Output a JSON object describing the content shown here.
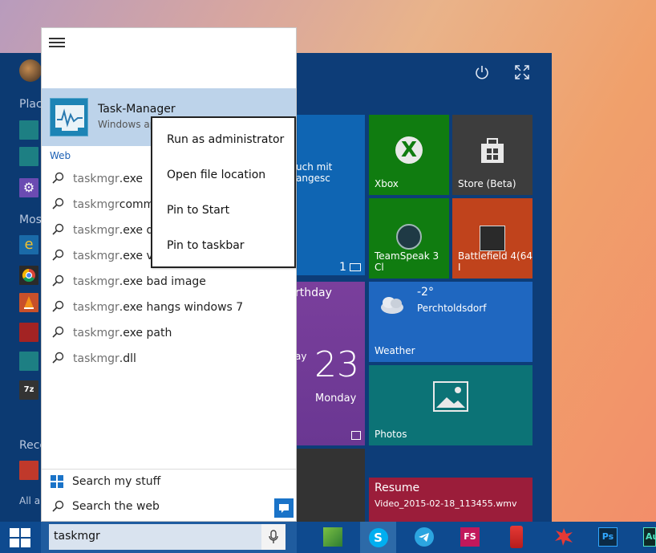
{
  "search_panel": {
    "best_match": {
      "title": "Task-Manager",
      "subtitle": "Windows ap"
    },
    "web_header": "Web",
    "suggestions": [
      {
        "query": "taskmgr",
        "rest": ".exe"
      },
      {
        "query": "taskmgr",
        "rest": " comm"
      },
      {
        "query": "taskmgr",
        "rest": ".exe do"
      },
      {
        "query": "taskmgr",
        "rest": ".exe vir"
      },
      {
        "query": "taskmgr",
        "rest": ".exe bad image"
      },
      {
        "query": "taskmgr",
        "rest": ".exe hangs windows 7"
      },
      {
        "query": "taskmgr",
        "rest": ".exe path"
      },
      {
        "query": "taskmgr",
        "rest": ".dll"
      }
    ],
    "search_my_stuff": "Search my stuff",
    "search_the_web": "Search the web"
  },
  "context_menu": {
    "items": [
      "Run as administrator",
      "Open file location",
      "Pin to Start",
      "Pin to taskbar"
    ]
  },
  "start_menu": {
    "left_labels": {
      "places": "Plac",
      "most_used": "Mos",
      "recent": "Rece",
      "all_apps": "All ap"
    }
  },
  "tiles": {
    "mail_text": "uch mit angesc",
    "mail_count": "1",
    "xbox": "Xbox",
    "store": "Store (Beta)",
    "teamspeak": "TeamSpeak 3 Cl",
    "battlefield": "Battlefield 4(64 I",
    "calendar_birthday": "rthday",
    "calendar_day_partial": "ay",
    "calendar_date": "23",
    "calendar_weekday": "Monday",
    "weather_temp": "-2°",
    "weather_location": "Perchtoldsdorf",
    "weather_label": "Weather",
    "photos": "Photos",
    "video_title": "Resume",
    "video_file": "Video_2015-02-18_113455.wmv"
  },
  "taskbar": {
    "search_value": "taskmgr",
    "fs_label": "FS",
    "ps_label": "Ps",
    "au_label": "Au"
  }
}
